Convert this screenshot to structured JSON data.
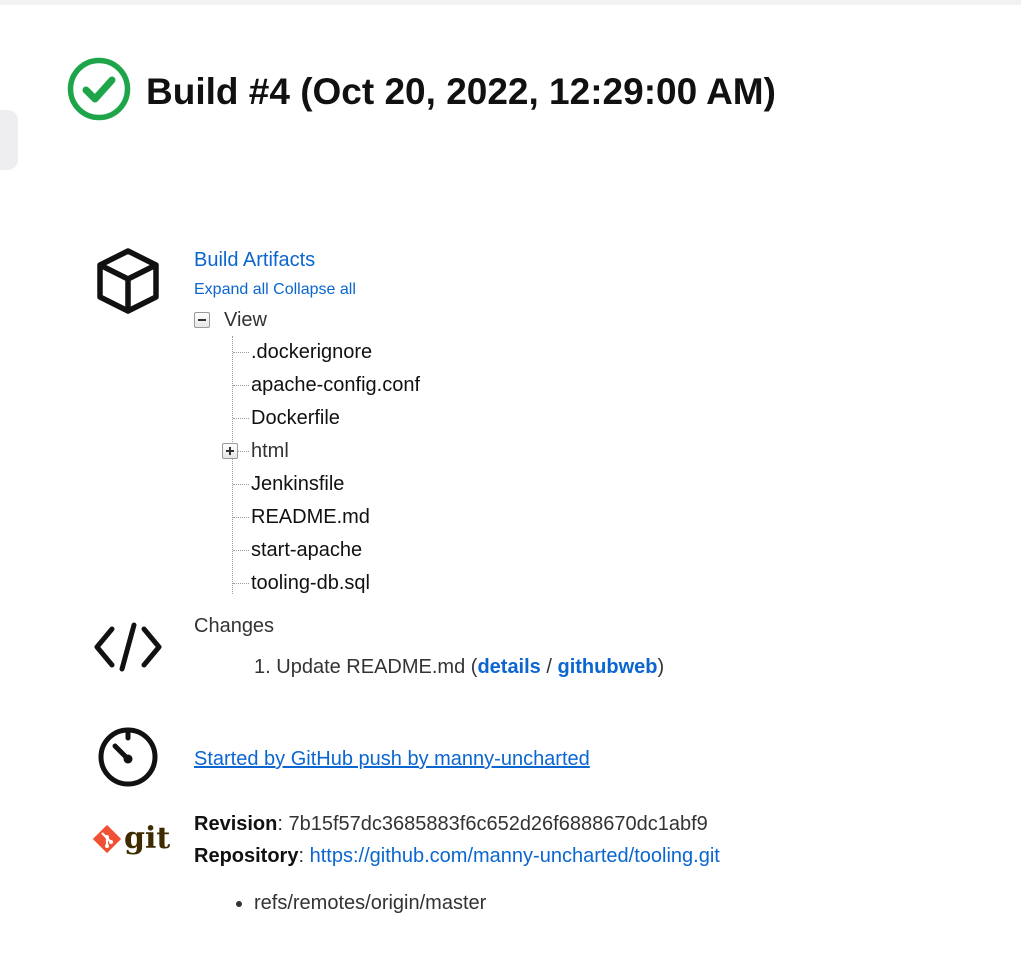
{
  "build": {
    "title": "Build #4 (Oct 20, 2022, 12:29:00 AM)",
    "status_color": "#1ea54a"
  },
  "artifacts": {
    "title": "Build Artifacts",
    "expand_all": "Expand all",
    "collapse_all": "Collapse all",
    "root": "View",
    "items": [
      {
        "name": ".dockerignore",
        "type": "file"
      },
      {
        "name": "apache-config.conf",
        "type": "file"
      },
      {
        "name": "Dockerfile",
        "type": "file"
      },
      {
        "name": "html",
        "type": "folder"
      },
      {
        "name": "Jenkinsfile",
        "type": "file"
      },
      {
        "name": "README.md",
        "type": "file"
      },
      {
        "name": "start-apache",
        "type": "file"
      },
      {
        "name": "tooling-db.sql",
        "type": "file"
      }
    ]
  },
  "changes": {
    "title": "Changes",
    "entries": [
      {
        "number": "1.",
        "message": "Update README.md",
        "details_label": "details",
        "separator": "/",
        "web_label": "githubweb"
      }
    ]
  },
  "cause": {
    "text": "Started by GitHub push by manny-uncharted"
  },
  "git": {
    "revision_label": "Revision",
    "revision": "7b15f57dc3685883f6c652d26f6888670dc1abf9",
    "repository_label": "Repository",
    "repository_url": "https://github.com/manny-uncharted/tooling.git",
    "refs": [
      "refs/remotes/origin/master"
    ],
    "logo_text": "git",
    "logo_color": "#f05033"
  },
  "icons": {
    "status": "check-circle-icon",
    "artifacts": "package-cube-icon",
    "changes": "code-icon",
    "cause": "timer-icon",
    "git": "git-logo"
  }
}
